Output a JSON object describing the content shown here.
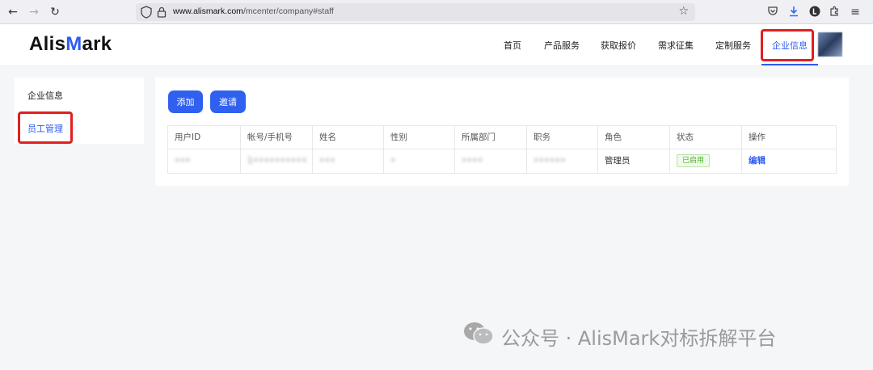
{
  "browser": {
    "url_domain": "www.alismark.com",
    "url_path": "/mcenter/company#staff"
  },
  "site": {
    "logo_prefix": "Alis",
    "logo_accent": "M",
    "logo_suffix": "ark",
    "nav": [
      {
        "label": "首页"
      },
      {
        "label": "产品服务"
      },
      {
        "label": "获取报价"
      },
      {
        "label": "需求征集"
      },
      {
        "label": "定制服务"
      },
      {
        "label": "企业信息"
      }
    ]
  },
  "sidebar": {
    "items": [
      {
        "label": "企业信息"
      },
      {
        "label": "员工管理"
      }
    ]
  },
  "toolbar": {
    "add_label": "添加",
    "invite_label": "邀请"
  },
  "table": {
    "headers": [
      "用户ID",
      "帐号/手机号",
      "姓名",
      "性别",
      "所属部门",
      "职务",
      "角色",
      "状态",
      "操作"
    ],
    "rows": [
      {
        "user_id": "•••",
        "account": "1••••••••••",
        "name": "•••",
        "gender": "•",
        "department": "••••",
        "position": "••••••",
        "role": "管理员",
        "status": "已启用",
        "action": "编辑"
      }
    ]
  },
  "watermark": {
    "text": "公众号 · AlisMark对标拆解平台"
  },
  "colors": {
    "brand_blue": "#2d5cf0",
    "button_blue": "#3060f0",
    "highlight_red": "#e02020",
    "status_green": "#52b030"
  }
}
